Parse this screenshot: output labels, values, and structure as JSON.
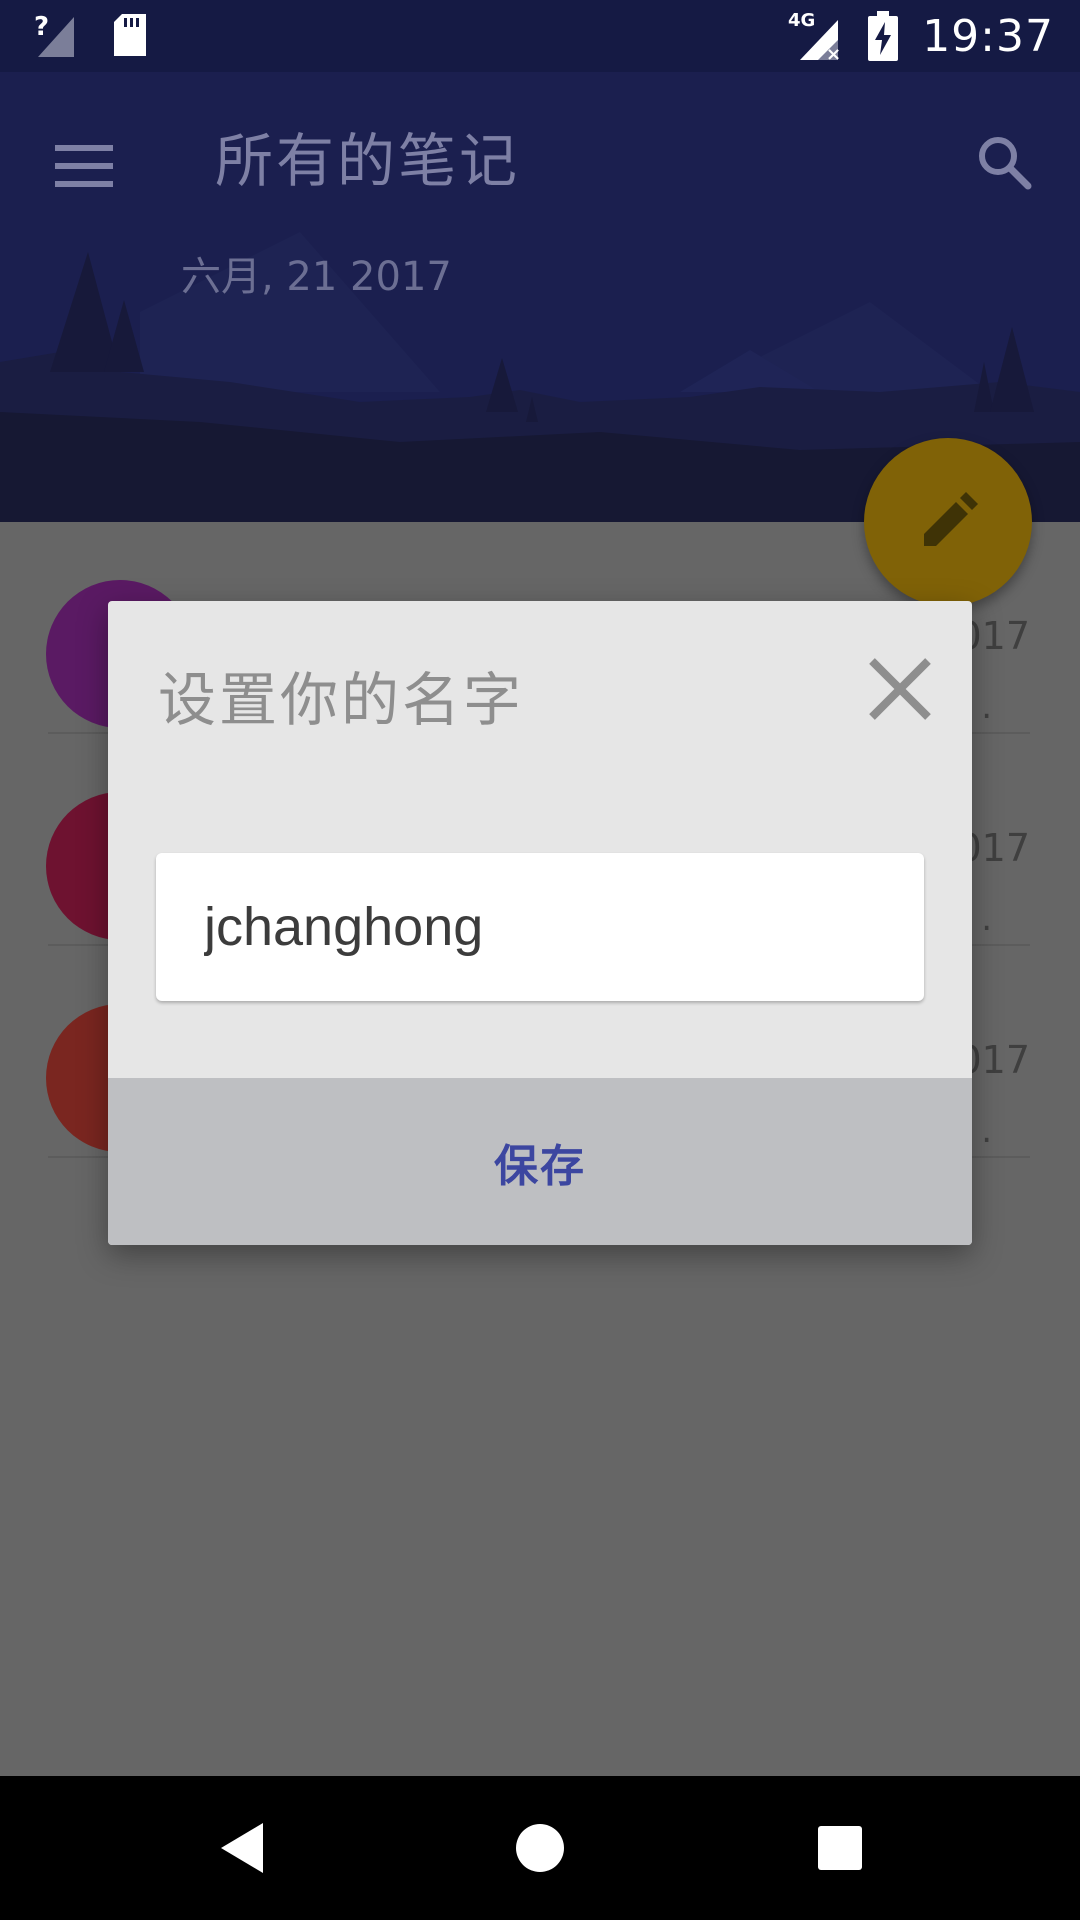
{
  "status_bar": {
    "time": "19:37",
    "network_type": "4G",
    "icons": [
      "signal-unknown-icon",
      "sd-card-icon",
      "signal-no-data-icon",
      "battery-charging-icon"
    ]
  },
  "header": {
    "title": "所有的笔记",
    "date": "六月, 21 2017",
    "menu_icon": "menu-icon",
    "search_icon": "search-icon",
    "background_color": "#1b1f4f"
  },
  "list": {
    "items": [
      {
        "avatar_color": "#5a1a63",
        "date_fragment": "017",
        "ellipsis": "."
      },
      {
        "avatar_color": "#6e1230",
        "date_fragment": "017",
        "ellipsis": "."
      },
      {
        "avatar_color": "#7a2620",
        "date_fragment": "017",
        "ellipsis": "."
      }
    ]
  },
  "fab": {
    "icon": "pencil-icon",
    "color": "#806207"
  },
  "dialog": {
    "title": "设置你的名字",
    "close_icon": "close-icon",
    "input_value": "jchanghong",
    "save_label": "保存",
    "save_color": "#3c46a0"
  },
  "nav_bar": {
    "icons": [
      "back-icon",
      "home-icon",
      "recents-icon"
    ]
  }
}
